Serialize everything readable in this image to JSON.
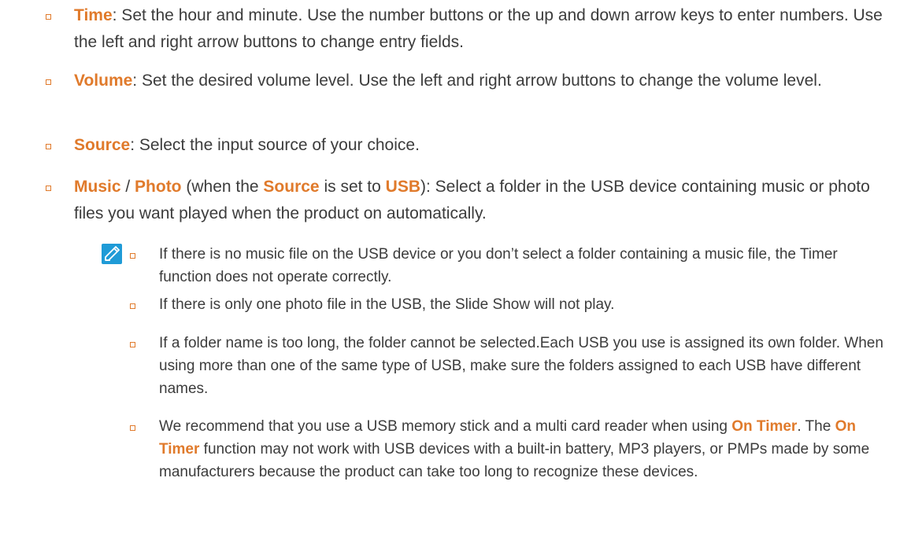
{
  "items": [
    {
      "term": "Time",
      "text": ": Set the hour and minute. Use the number buttons or the up and down arrow keys to enter numbers. Use the left and right arrow buttons to change entry fields."
    },
    {
      "term": "Volume",
      "text": ": Set the desired volume level. Use the left and right arrow buttons to change the volume level."
    },
    {
      "term": "Source",
      "text": ": Select the input source of your choice."
    },
    {
      "term_a": "Music",
      "sep": " / ",
      "term_b": "Photo",
      "text_a": " (when the ",
      "term_c": "Source",
      "text_b": " is set to ",
      "term_d": "USB",
      "text_c": "): Select a folder in the USB device containing music or photo files you want played when the product on automatically."
    }
  ],
  "notes": [
    {
      "text": "If there is no music file on the USB device or you don’t select a folder containing a music file, the Timer function does not operate correctly."
    },
    {
      "text": "If there is only one photo file in the USB, the Slide Show will not play."
    },
    {
      "text": "If a folder name is too long, the folder cannot be selected.Each USB you use is assigned its own folder. When using more than one of the same type of USB, make sure the folders assigned to each USB have different names."
    },
    {
      "text_a": "We recommend that you use a USB memory stick and a multi card reader when using ",
      "term_a": "On Timer",
      "text_b": ". The ",
      "term_b": "On Timer",
      "text_c": " function may not work with USB devices with a built-in battery, MP3 players, or PMPs made by some manufacturers because the product can take too long to recognize these devices."
    }
  ],
  "icons": {
    "note": "note-pencil-icon",
    "bullet": "square-bullet-icon"
  },
  "colors": {
    "highlight": "#e07a2b",
    "text": "#3c3c3c",
    "note_icon": "#1f9bd7"
  }
}
